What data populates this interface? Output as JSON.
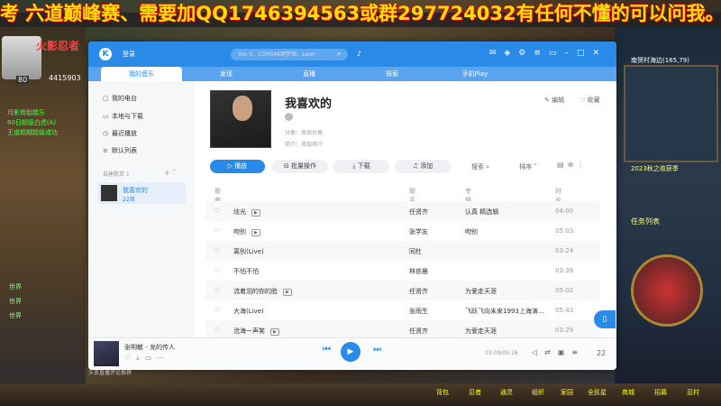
{
  "banner": {
    "text": "考 六道巅峰赛、需要加QQ1746394563或群297724032有任何不懂的可以问我。办卡帮"
  },
  "game": {
    "hp": "4415903",
    "level": "80",
    "logo": "火影忍者",
    "quests": [
      "月影骨骷髅乐",
      "60日超级白虎(A)",
      "王道超越超级成功"
    ],
    "chat": [
      "世界",
      "世界",
      "世界"
    ],
    "minimap_title": "南贺村海边(165,79)",
    "badge": "2023秋之收获季",
    "task_title": "任务列表",
    "bottom": [
      "背包",
      "忍者",
      "通灵",
      "组织",
      "家园",
      "全民星",
      "商城",
      "招募",
      "忍村"
    ]
  },
  "app": {
    "login": "登录",
    "search_placeholder": "Yoo V、CORSAK胡梦周、Leon",
    "tabs": [
      "我的音乐",
      "发现",
      "直播",
      "探索",
      "手机Play"
    ],
    "sidebar": {
      "items": [
        "我的电台",
        "本地与下载",
        "最近播放",
        "默认列表"
      ],
      "section": "自建歌单 1",
      "playlist_name": "我喜欢的",
      "playlist_count": "22首"
    },
    "playlist": {
      "title": "我喜欢的",
      "category": "分类：添加分类",
      "intro": "简介：添加简介",
      "edit": "编辑",
      "fav": "收藏"
    },
    "buttons": {
      "play": "播放",
      "batch": "批量操作",
      "download": "下载",
      "add": "添加",
      "search": "搜索",
      "sort": "排序"
    },
    "columns": {
      "name": "歌曲名",
      "singer": "歌手",
      "album": "专辑",
      "time": "时长"
    },
    "songs": [
      {
        "name": "炫光",
        "mv": "▶",
        "singer": "任贤齐",
        "album": "认真 精选辑",
        "time": "04:00"
      },
      {
        "name": "吻别",
        "mv": "▶",
        "singer": "张学友",
        "album": "吻别",
        "time": "05:03"
      },
      {
        "name": "离别(Live)",
        "mv": "",
        "singer": "同杜",
        "album": "",
        "time": "03:24"
      },
      {
        "name": "不怕不怕",
        "mv": "",
        "singer": "林依晨",
        "album": "",
        "time": "03:36"
      },
      {
        "name": "流着泪的你的脸",
        "mv": "▶",
        "singer": "任贤齐",
        "album": "为爱走天涯",
        "time": "05:02"
      },
      {
        "name": "大海(Live)",
        "mv": "",
        "singer": "张雨生",
        "album": "飞跃飞向未来1993上海演...",
        "time": "05:43"
      },
      {
        "name": "沧海一声笑",
        "mv": "▶",
        "singer": "任贤齐",
        "album": "为爱走天涯",
        "time": "03:29"
      }
    ],
    "player": {
      "now_playing": "张明敏 - 龙的传人",
      "time": "03:09/05:16",
      "count": "22"
    },
    "status": "头条直播评论推荐"
  },
  "colors": {
    "accent": "#2a8ae8",
    "banner": "#ffe000"
  }
}
